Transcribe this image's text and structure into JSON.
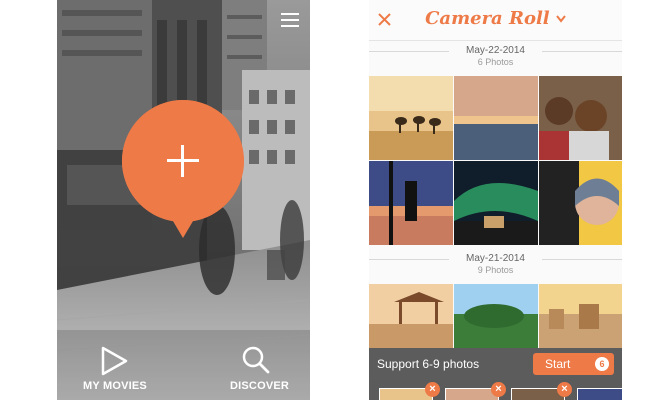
{
  "colors": {
    "accent": "#ee7a47",
    "tray": "#5b5b5b",
    "support_bar": "#464646"
  },
  "left_screen": {
    "menu_icon": "hamburger-icon",
    "add_icon": "plus-icon",
    "tabs": [
      {
        "label": "MY MOVIES",
        "icon": "play-icon"
      },
      {
        "label": "DISCOVER",
        "icon": "magnifier-icon"
      }
    ]
  },
  "camera_roll": {
    "close_icon": "close-x-icon",
    "title": "Camera Roll",
    "dropdown_icon": "chevron-down-icon",
    "sections": [
      {
        "date": "May-22-2014",
        "count": "6 Photos"
      },
      {
        "date": "May-21-2014",
        "count": "9 Photos"
      }
    ],
    "support_text": "Support 6-9 photos",
    "start_label": "Start",
    "selected_count": "6",
    "remove_icon": "remove-x-icon"
  }
}
